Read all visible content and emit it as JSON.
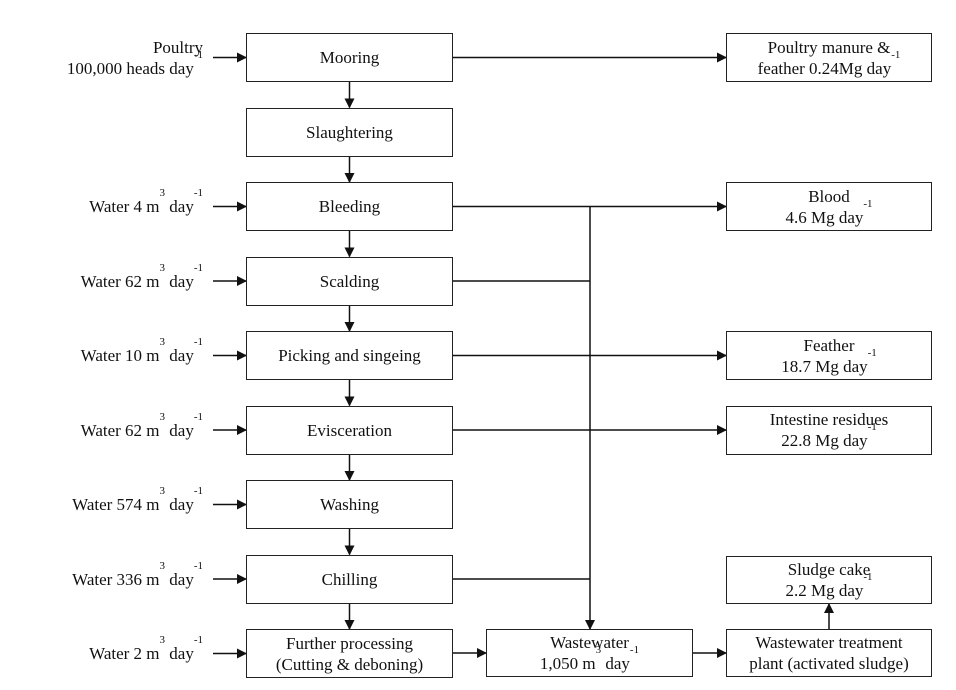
{
  "process_steps": [
    {
      "id": "mooring",
      "lines": [
        [
          {
            "t": "Mooring"
          }
        ]
      ]
    },
    {
      "id": "slaughtering",
      "lines": [
        [
          {
            "t": "Slaughtering"
          }
        ]
      ]
    },
    {
      "id": "bleeding",
      "lines": [
        [
          {
            "t": "Bleeding"
          }
        ]
      ]
    },
    {
      "id": "scalding",
      "lines": [
        [
          {
            "t": "Scalding"
          }
        ]
      ]
    },
    {
      "id": "picking",
      "lines": [
        [
          {
            "t": "Picking and singeing"
          }
        ]
      ]
    },
    {
      "id": "evisceration",
      "lines": [
        [
          {
            "t": "Evisceration"
          }
        ]
      ]
    },
    {
      "id": "washing",
      "lines": [
        [
          {
            "t": "Washing"
          }
        ]
      ]
    },
    {
      "id": "chilling",
      "lines": [
        [
          {
            "t": "Chilling"
          }
        ]
      ]
    },
    {
      "id": "further-processing",
      "lines": [
        [
          {
            "t": "Further processing"
          }
        ],
        [
          {
            "t": "(Cutting & deboning)"
          }
        ]
      ]
    }
  ],
  "inputs": [
    {
      "step": 0,
      "lines": [
        [
          {
            "t": "Poultry"
          }
        ],
        [
          {
            "t": "100,000 heads day"
          },
          {
            "s": "-1"
          }
        ]
      ]
    },
    {
      "step": 2,
      "lines": [
        [
          {
            "t": "Water 4 m"
          },
          {
            "s": "3"
          },
          {
            "t": " day"
          },
          {
            "s": "-1"
          }
        ]
      ]
    },
    {
      "step": 3,
      "lines": [
        [
          {
            "t": "Water 62 m"
          },
          {
            "s": "3"
          },
          {
            "t": " day"
          },
          {
            "s": "-1"
          }
        ]
      ]
    },
    {
      "step": 4,
      "lines": [
        [
          {
            "t": "Water 10 m"
          },
          {
            "s": "3"
          },
          {
            "t": " day"
          },
          {
            "s": "-1"
          }
        ]
      ]
    },
    {
      "step": 5,
      "lines": [
        [
          {
            "t": "Water 62 m"
          },
          {
            "s": "3"
          },
          {
            "t": " day"
          },
          {
            "s": "-1"
          }
        ]
      ]
    },
    {
      "step": 6,
      "lines": [
        [
          {
            "t": "Water 574 m"
          },
          {
            "s": "3"
          },
          {
            "t": " day"
          },
          {
            "s": "-1"
          }
        ]
      ]
    },
    {
      "step": 7,
      "lines": [
        [
          {
            "t": "Water 336 m"
          },
          {
            "s": "3"
          },
          {
            "t": " day"
          },
          {
            "s": "-1"
          }
        ]
      ]
    },
    {
      "step": 8,
      "lines": [
        [
          {
            "t": "Water 2 m"
          },
          {
            "s": "3"
          },
          {
            "t": " day"
          },
          {
            "s": "-1"
          }
        ]
      ]
    }
  ],
  "outputs": [
    {
      "step": 0,
      "lines": [
        [
          {
            "t": "Poultry manure &"
          }
        ],
        [
          {
            "t": "feather  0.24Mg day"
          },
          {
            "s": "-1"
          }
        ]
      ]
    },
    {
      "step": 2,
      "lines": [
        [
          {
            "t": "Blood"
          }
        ],
        [
          {
            "t": "4.6 Mg day"
          },
          {
            "s": "-1"
          }
        ]
      ]
    },
    {
      "step": 4,
      "lines": [
        [
          {
            "t": "Feather"
          }
        ],
        [
          {
            "t": "18.7 Mg day"
          },
          {
            "s": "-1"
          }
        ]
      ]
    },
    {
      "step": 5,
      "lines": [
        [
          {
            "t": "Intestine residues"
          }
        ],
        [
          {
            "t": "22.8 Mg day"
          },
          {
            "s": "-1"
          }
        ]
      ]
    }
  ],
  "wastewater": {
    "lines": [
      [
        {
          "t": "Wastewater"
        }
      ],
      [
        {
          "t": "1,050 m"
        },
        {
          "s": "3"
        },
        {
          "t": " day"
        },
        {
          "s": "-1"
        }
      ]
    ]
  },
  "treatment": {
    "lines": [
      [
        {
          "t": "Wastewater treatment"
        }
      ],
      [
        {
          "t": "plant (activated sludge)"
        }
      ]
    ]
  },
  "sludge": {
    "lines": [
      [
        {
          "t": "Sludge cake"
        }
      ],
      [
        {
          "t": "2.2 Mg day"
        },
        {
          "s": "-1"
        }
      ]
    ]
  },
  "wastewater_sources": [
    2,
    3,
    7
  ]
}
